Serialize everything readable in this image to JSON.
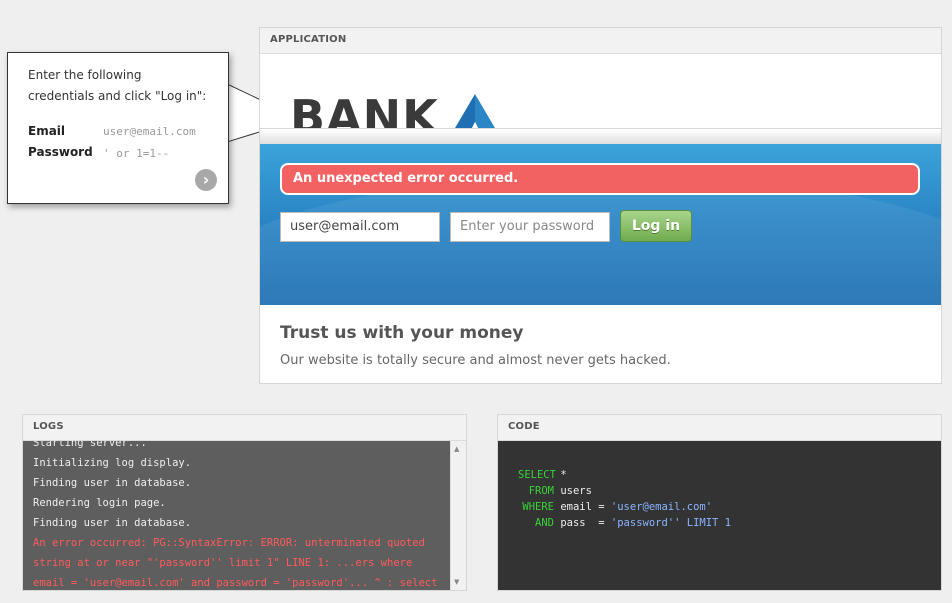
{
  "app": {
    "header": "APPLICATION",
    "logo_text": "BANK",
    "error_message": "An unexpected error occurred.",
    "email_value": "user@email.com",
    "password_placeholder": "Enter your password",
    "login_label": "Log in",
    "tagline": "Trust us with your money",
    "subtext": "Our website is totally secure and almost never gets hacked."
  },
  "tooltip": {
    "line1": "Enter the following",
    "line2": "credentials and click \"Log in\":",
    "email_label": "Email",
    "email_value": "user@email.com",
    "password_label": "Password",
    "password_value": "' or 1=1--",
    "next_icon": "chevron-right-icon"
  },
  "logs": {
    "header": "LOGS",
    "lines": [
      "Starting server...",
      "Initializing log display.",
      "Finding user in database.",
      "Rendering login page.",
      "Finding user in database."
    ],
    "error": "An error occurred: PG::SyntaxError: ERROR: unterminated quoted string at or near \"'password'' limit 1\" LINE 1: ...ers where email = 'user@email.com' and password = 'password'... ^ : select * from"
  },
  "code": {
    "header": "CODE",
    "lines": [
      {
        "kw": "SELECT",
        "text": " *",
        "str": "",
        "tail": ""
      },
      {
        "kw": "FROM",
        "text": " users",
        "str": "",
        "tail": ""
      },
      {
        "kw": "WHERE",
        "text": " email = ",
        "str": "'user@email.com'",
        "tail": ""
      },
      {
        "kw": "AND",
        "text": " pass  = ",
        "str": "'password''",
        "tail": " LIMIT 1"
      }
    ]
  },
  "colors": {
    "error_red": "#f36262",
    "login_green": "#6fab4e",
    "logo_blue": "#2b86c6",
    "log_error": "#ff5a5a",
    "sql_keyword": "#38d238",
    "sql_string": "#8ab4ff"
  }
}
